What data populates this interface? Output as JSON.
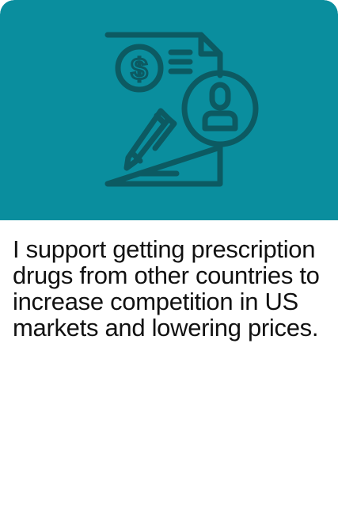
{
  "card": {
    "statement": "I support getting prescription drugs from other countries to increase competition in US markets and lowering prices.",
    "icon": "document-dollar-person-pen-icon"
  },
  "colors": {
    "hero_background": "#0a8e9e",
    "icon_stroke": "#0c5a62",
    "text": "#111111",
    "card_background": "#ffffff"
  }
}
